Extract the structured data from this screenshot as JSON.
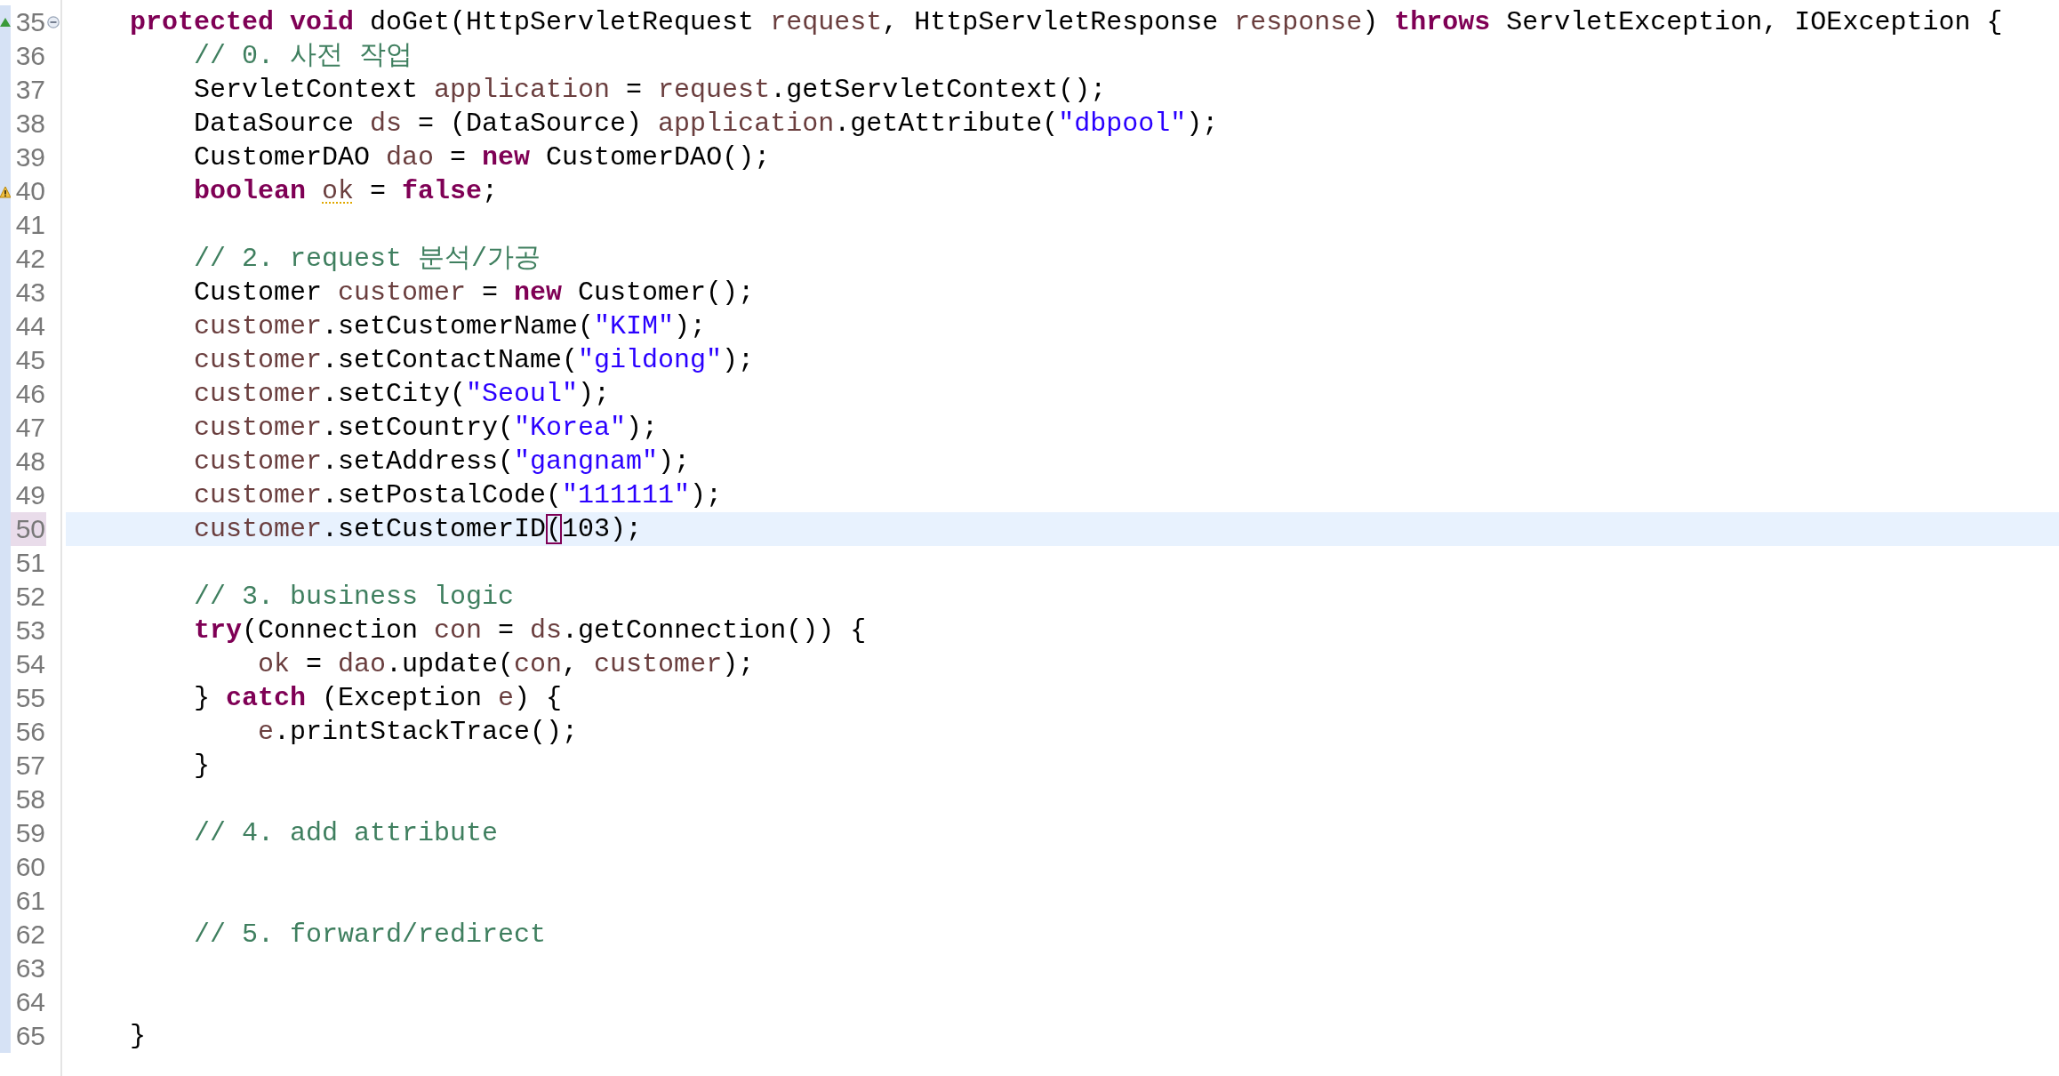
{
  "editor": {
    "lines": [
      {
        "number": "35",
        "current": false,
        "override": true,
        "warning": false,
        "foldable": true,
        "code": [
          {
            "kind": "keyword",
            "text": "protected "
          },
          {
            "kind": "keyword",
            "text": "void"
          },
          {
            "kind": "plain",
            "text": " doGet(HttpServletRequest "
          },
          {
            "kind": "variable",
            "text": "request"
          },
          {
            "kind": "plain",
            "text": ", HttpServletResponse "
          },
          {
            "kind": "variable",
            "text": "response"
          },
          {
            "kind": "plain",
            "text": ") "
          },
          {
            "kind": "keyword",
            "text": "throws"
          },
          {
            "kind": "plain",
            "text": " ServletException, IOException {"
          }
        ],
        "children": [
          {
            "number": "36",
            "current": false,
            "override": false,
            "warning": false,
            "foldable": false,
            "code": [
              {
                "kind": "comment",
                "text": "// 0. 사전 작업"
              }
            ]
          },
          {
            "number": "37",
            "current": false,
            "override": false,
            "warning": false,
            "foldable": false,
            "code": [
              {
                "kind": "plain",
                "text": "ServletContext "
              },
              {
                "kind": "variable",
                "text": "application"
              },
              {
                "kind": "plain",
                "text": " = "
              },
              {
                "kind": "variable",
                "text": "request"
              },
              {
                "kind": "plain",
                "text": ".getServletContext();"
              }
            ]
          },
          {
            "number": "38",
            "current": false,
            "override": false,
            "warning": false,
            "foldable": false,
            "code": [
              {
                "kind": "plain",
                "text": "DataSource "
              },
              {
                "kind": "variable",
                "text": "ds"
              },
              {
                "kind": "plain",
                "text": " = (DataSource) "
              },
              {
                "kind": "variable",
                "text": "application"
              },
              {
                "kind": "plain",
                "text": ".getAttribute("
              },
              {
                "kind": "string",
                "text": "\"dbpool\""
              },
              {
                "kind": "plain",
                "text": ");"
              }
            ]
          },
          {
            "number": "39",
            "current": false,
            "override": false,
            "warning": false,
            "foldable": false,
            "code": [
              {
                "kind": "plain",
                "text": "CustomerDAO "
              },
              {
                "kind": "variable",
                "text": "dao"
              },
              {
                "kind": "plain",
                "text": " = "
              },
              {
                "kind": "keyword",
                "text": "new"
              },
              {
                "kind": "plain",
                "text": " CustomerDAO();"
              }
            ]
          },
          {
            "number": "40",
            "current": false,
            "override": false,
            "warning": true,
            "foldable": false,
            "code": [
              {
                "kind": "keyword",
                "text": "boolean "
              },
              {
                "kind": "warning-variable",
                "text": "ok"
              },
              {
                "kind": "plain",
                "text": " = "
              },
              {
                "kind": "keyword",
                "text": "false"
              },
              {
                "kind": "plain",
                "text": ";"
              }
            ]
          },
          {
            "number": "41",
            "current": false,
            "override": false,
            "warning": false,
            "foldable": false
          },
          {
            "number": "42",
            "current": false,
            "override": false,
            "warning": false,
            "foldable": false,
            "code": [
              {
                "kind": "comment",
                "text": "// 2. request 분석/가공"
              }
            ]
          },
          {
            "number": "43",
            "current": false,
            "override": false,
            "warning": false,
            "foldable": false,
            "code": [
              {
                "kind": "plain",
                "text": "Customer "
              },
              {
                "kind": "variable",
                "text": "customer"
              },
              {
                "kind": "plain",
                "text": " = "
              },
              {
                "kind": "keyword",
                "text": "new"
              },
              {
                "kind": "plain",
                "text": " Customer();"
              }
            ]
          },
          {
            "number": "44",
            "current": false,
            "override": false,
            "warning": false,
            "foldable": false,
            "code": [
              {
                "kind": "variable",
                "text": "customer"
              },
              {
                "kind": "plain",
                "text": ".setCustomerName("
              },
              {
                "kind": "string",
                "text": "\"KIM\""
              },
              {
                "kind": "plain",
                "text": ");"
              }
            ]
          },
          {
            "number": "45",
            "current": false,
            "override": false,
            "warning": false,
            "foldable": false,
            "code": [
              {
                "kind": "variable",
                "text": "customer"
              },
              {
                "kind": "plain",
                "text": ".setContactName("
              },
              {
                "kind": "string",
                "text": "\"gildong\""
              },
              {
                "kind": "plain",
                "text": ");"
              }
            ]
          },
          {
            "number": "46",
            "current": false,
            "override": false,
            "warning": false,
            "foldable": false,
            "code": [
              {
                "kind": "variable",
                "text": "customer"
              },
              {
                "kind": "plain",
                "text": ".setCity("
              },
              {
                "kind": "string",
                "text": "\"Seoul\""
              },
              {
                "kind": "plain",
                "text": ");"
              }
            ]
          },
          {
            "number": "47",
            "current": false,
            "override": false,
            "warning": false,
            "foldable": false,
            "code": [
              {
                "kind": "variable",
                "text": "customer"
              },
              {
                "kind": "plain",
                "text": ".setCountry("
              },
              {
                "kind": "string",
                "text": "\"Korea\""
              },
              {
                "kind": "plain",
                "text": ");"
              }
            ]
          },
          {
            "number": "48",
            "current": false,
            "override": false,
            "warning": false,
            "foldable": false,
            "code": [
              {
                "kind": "variable",
                "text": "customer"
              },
              {
                "kind": "plain",
                "text": ".setAddress("
              },
              {
                "kind": "string",
                "text": "\"gangnam\""
              },
              {
                "kind": "plain",
                "text": ");"
              }
            ]
          },
          {
            "number": "49",
            "current": false,
            "override": false,
            "warning": false,
            "foldable": false,
            "code": [
              {
                "kind": "variable",
                "text": "customer"
              },
              {
                "kind": "plain",
                "text": ".setPostalCode("
              },
              {
                "kind": "string",
                "text": "\"111111\""
              },
              {
                "kind": "plain",
                "text": ");"
              }
            ]
          },
          {
            "number": "50",
            "current": true,
            "override": false,
            "warning": false,
            "foldable": false,
            "code": [
              {
                "kind": "variable",
                "text": "customer"
              },
              {
                "kind": "plain",
                "text": ".setCustomerID"
              },
              {
                "kind": "matched-bracket",
                "text": "("
              },
              {
                "kind": "plain",
                "text": "103);"
              }
            ]
          },
          {
            "number": "51",
            "current": false,
            "override": false,
            "warning": false,
            "foldable": false
          },
          {
            "number": "52",
            "current": false,
            "override": false,
            "warning": false,
            "foldable": false,
            "code": [
              {
                "kind": "comment",
                "text": "// 3. business logic"
              }
            ]
          },
          {
            "number": "53",
            "current": false,
            "override": false,
            "warning": false,
            "foldable": false,
            "code": [
              {
                "kind": "keyword",
                "text": "try"
              },
              {
                "kind": "plain",
                "text": "(Connection "
              },
              {
                "kind": "variable",
                "text": "con"
              },
              {
                "kind": "plain",
                "text": " = "
              },
              {
                "kind": "variable",
                "text": "ds"
              },
              {
                "kind": "plain",
                "text": ".getConnection()) {"
              }
            ],
            "children": [
              {
                "number": "54",
                "current": false,
                "override": false,
                "warning": false,
                "foldable": false,
                "code": [
                  {
                    "kind": "variable",
                    "text": "ok"
                  },
                  {
                    "kind": "plain",
                    "text": " = "
                  },
                  {
                    "kind": "variable",
                    "text": "dao"
                  },
                  {
                    "kind": "plain",
                    "text": ".update("
                  },
                  {
                    "kind": "variable",
                    "text": "con"
                  },
                  {
                    "kind": "plain",
                    "text": ", "
                  },
                  {
                    "kind": "variable",
                    "text": "customer"
                  },
                  {
                    "kind": "plain",
                    "text": ");"
                  }
                ]
              }
            ]
          },
          {
            "number": "55",
            "current": false,
            "override": false,
            "warning": false,
            "foldable": false,
            "code": [
              {
                "kind": "plain",
                "text": "} "
              },
              {
                "kind": "keyword",
                "text": "catch"
              },
              {
                "kind": "plain",
                "text": " (Exception "
              },
              {
                "kind": "variable",
                "text": "e"
              },
              {
                "kind": "plain",
                "text": ") {"
              }
            ],
            "children": [
              {
                "number": "56",
                "current": false,
                "override": false,
                "warning": false,
                "foldable": false,
                "code": [
                  {
                    "kind": "variable",
                    "text": "e"
                  },
                  {
                    "kind": "plain",
                    "text": ".printStackTrace();"
                  }
                ]
              }
            ]
          },
          {
            "number": "57",
            "current": false,
            "override": false,
            "warning": false,
            "foldable": false,
            "code": [
              {
                "kind": "plain",
                "text": "}"
              }
            ]
          },
          {
            "number": "58",
            "current": false,
            "override": false,
            "warning": false,
            "foldable": false
          },
          {
            "number": "59",
            "current": false,
            "override": false,
            "warning": false,
            "foldable": false,
            "code": [
              {
                "kind": "comment",
                "text": "// 4. add attribute"
              }
            ]
          },
          {
            "number": "60",
            "current": false,
            "override": false,
            "warning": false,
            "foldable": false
          },
          {
            "number": "61",
            "current": false,
            "override": false,
            "warning": false,
            "foldable": false
          },
          {
            "number": "62",
            "current": false,
            "override": false,
            "warning": false,
            "foldable": false,
            "code": [
              {
                "kind": "comment",
                "text": "// 5. forward/redirect"
              }
            ]
          },
          {
            "number": "63",
            "current": false,
            "override": false,
            "warning": false,
            "foldable": false
          },
          {
            "number": "64",
            "current": false,
            "override": false,
            "warning": false,
            "foldable": false
          }
        ]
      },
      {
        "number": "65",
        "current": false,
        "override": false,
        "warning": false,
        "foldable": false,
        "code": [
          {
            "kind": "plain",
            "text": "}"
          }
        ]
      }
    ]
  }
}
